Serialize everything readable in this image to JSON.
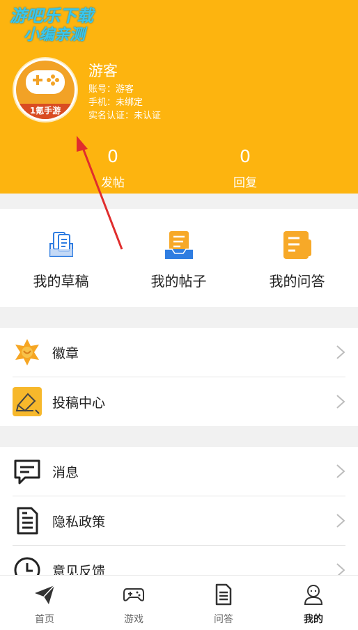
{
  "watermark": {
    "line1": "游吧乐下载",
    "line2": "小编亲测"
  },
  "profile": {
    "avatar_badge": "1氪手游",
    "name": "游客",
    "account": "账号：游客",
    "phone": "手机：未绑定",
    "realname": "实名认证：未认证"
  },
  "stats": [
    {
      "value": "0",
      "label": "发帖"
    },
    {
      "value": "0",
      "label": "回复"
    }
  ],
  "shortcuts": [
    {
      "label": "我的草稿",
      "icon": "drafts-icon"
    },
    {
      "label": "我的帖子",
      "icon": "posts-icon"
    },
    {
      "label": "我的问答",
      "icon": "qa-icon"
    }
  ],
  "menu_group1": [
    {
      "label": "徽章",
      "icon": "badge-icon"
    },
    {
      "label": "投稿中心",
      "icon": "submission-icon"
    }
  ],
  "menu_group2": [
    {
      "label": "消息",
      "icon": "message-icon"
    },
    {
      "label": "隐私政策",
      "icon": "privacy-document-icon"
    },
    {
      "label": "意见反馈",
      "icon": "feedback-clock-icon"
    }
  ],
  "tabbar": [
    {
      "label": "首页",
      "icon": "paper-plane-icon",
      "active": false
    },
    {
      "label": "游戏",
      "icon": "gamepad-icon",
      "active": false
    },
    {
      "label": "问答",
      "icon": "document-icon",
      "active": false
    },
    {
      "label": "我的",
      "icon": "user-icon",
      "active": true
    }
  ],
  "colors": {
    "header": "#fdb40f",
    "accent_blue": "#2f7de1",
    "annotation_arrow": "#e02d2d"
  }
}
